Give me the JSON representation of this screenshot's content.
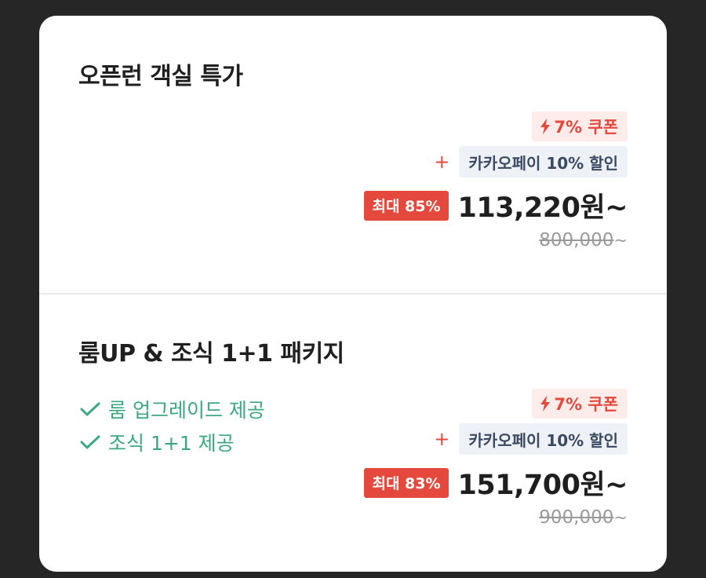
{
  "offers": [
    {
      "title": "오픈런 객실 특가",
      "coupon": "7% 쿠폰",
      "coupon_icon": "lightning-icon",
      "pay_plus": "+",
      "pay_discount": "카카오페이 10% 할인",
      "max_discount": "최대 85%",
      "price": "113,220원~",
      "original_price": "800,000",
      "original_suffix": "~",
      "features": []
    },
    {
      "title": "룸UP & 조식 1+1 패키지",
      "coupon": "7% 쿠폰",
      "coupon_icon": "lightning-icon",
      "pay_plus": "+",
      "pay_discount": "카카오페이 10% 할인",
      "max_discount": "최대 83%",
      "price": "151,700원~",
      "original_price": "900,000",
      "original_suffix": "~",
      "features": [
        "룸 업그레이드 제공",
        "조식 1+1 제공"
      ]
    }
  ],
  "colors": {
    "accent_red": "#e5483c",
    "coupon_bg": "#fdecea",
    "pay_bg": "#eef1f6",
    "pay_text": "#3b4a63",
    "feature_green": "#3aa981",
    "background": "#262626"
  }
}
